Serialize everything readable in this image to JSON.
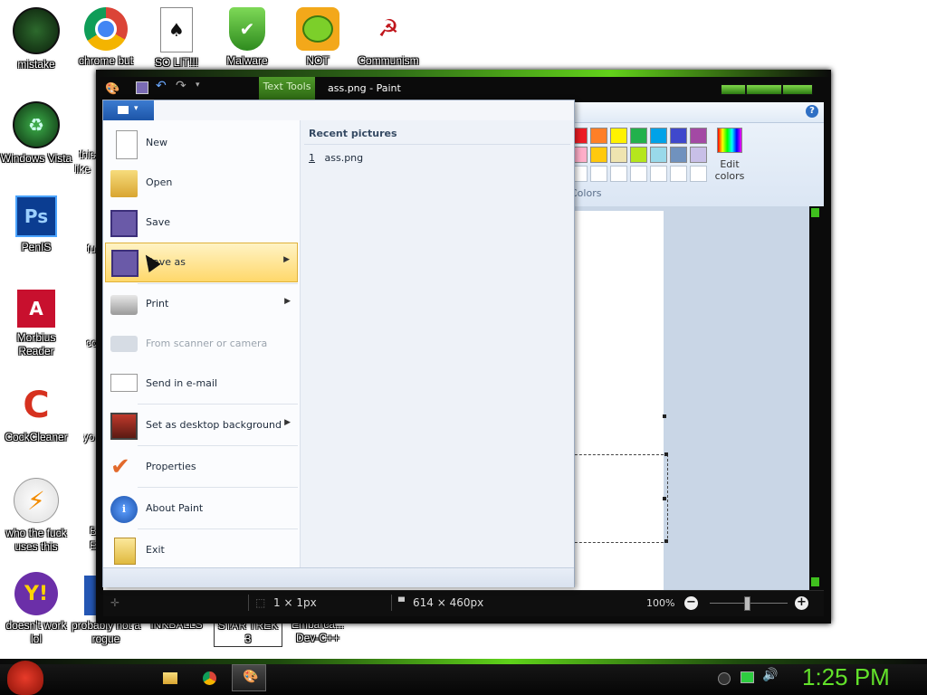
{
  "desktop": {
    "icons": [
      {
        "label": "mistake",
        "icon": "mistake-icon"
      },
      {
        "label": "chrome but nor",
        "icon": "chrome-icon"
      },
      {
        "label": "SO LIT!!!",
        "icon": "solitaire-icon"
      },
      {
        "label": "Malware",
        "icon": "shield-icon"
      },
      {
        "label": "NOT",
        "icon": "angry-birds-pig-icon"
      },
      {
        "label": "Communism",
        "icon": "communism-icon"
      },
      {
        "label": "Windows Vista",
        "icon": "recycle-bin-icon"
      },
      {
        "label": "PenIS",
        "icon": "photoshop-icon"
      },
      {
        "label": "Morbius Reader",
        "icon": "adobe-reader-icon"
      },
      {
        "label": "CockCleaner",
        "icon": "ccleaner-icon"
      },
      {
        "label": "who the fuck uses this",
        "icon": "winamp-icon"
      },
      {
        "label": "doesn't work lol",
        "icon": "yahoo-messenger-icon"
      },
      {
        "label": "probably not a rogue",
        "icon": "rogue-icon"
      },
      {
        "label": "INKBALLS",
        "icon": "inkball-icon"
      },
      {
        "label": "STAR TREK 3",
        "icon": "star-trek-icon"
      },
      {
        "label": "Embarca... Dev-C++",
        "icon": "dev-cpp-icon"
      }
    ],
    "partial_labels": [
      "this",
      "like",
      "fu",
      "co",
      "yo",
      "B",
      "E"
    ]
  },
  "paint": {
    "title": "ass.png - Paint",
    "context_tab": "Text Tools",
    "help_label": "?",
    "edit_colors": "Edit colors",
    "colors_label": "Colors",
    "palette_row1": [
      "#ed1c24",
      "#ff7f27",
      "#fff200",
      "#22b14c",
      "#00a2e8",
      "#3f48cc",
      "#a349a4"
    ],
    "palette_row2": [
      "#ffaec9",
      "#ffc90e",
      "#efe4b0",
      "#b5e61d",
      "#99d9ea",
      "#7092be",
      "#c8bfe7"
    ],
    "status": {
      "selection_size": "1 × 1px",
      "image_size": "614 × 460px",
      "zoom": "100%"
    }
  },
  "file_menu": {
    "items": [
      {
        "label": "New",
        "icon": "new-file-icon"
      },
      {
        "label": "Open",
        "icon": "open-folder-icon"
      },
      {
        "label": "Save",
        "icon": "save-icon"
      },
      {
        "label": "Save as",
        "icon": "save-as-icon",
        "highlighted": true,
        "submenu": true
      },
      {
        "label": "Print",
        "icon": "printer-icon",
        "submenu": true
      },
      {
        "label": "From scanner or camera",
        "icon": "scanner-icon",
        "disabled": true
      },
      {
        "label": "Send in e-mail",
        "icon": "email-icon"
      },
      {
        "label": "Set as desktop background",
        "icon": "desktop-background-icon",
        "submenu": true
      },
      {
        "label": "Properties",
        "icon": "checkmark-icon"
      },
      {
        "label": "About Paint",
        "icon": "info-icon"
      },
      {
        "label": "Exit",
        "icon": "exit-icon"
      }
    ],
    "recent_title": "Recent pictures",
    "recent": [
      {
        "num": "1",
        "name": "ass.png"
      }
    ]
  },
  "taskbar": {
    "clock": "1:25 PM",
    "pinned": [
      "file-explorer-icon",
      "chrome-icon",
      "paint-icon"
    ]
  }
}
